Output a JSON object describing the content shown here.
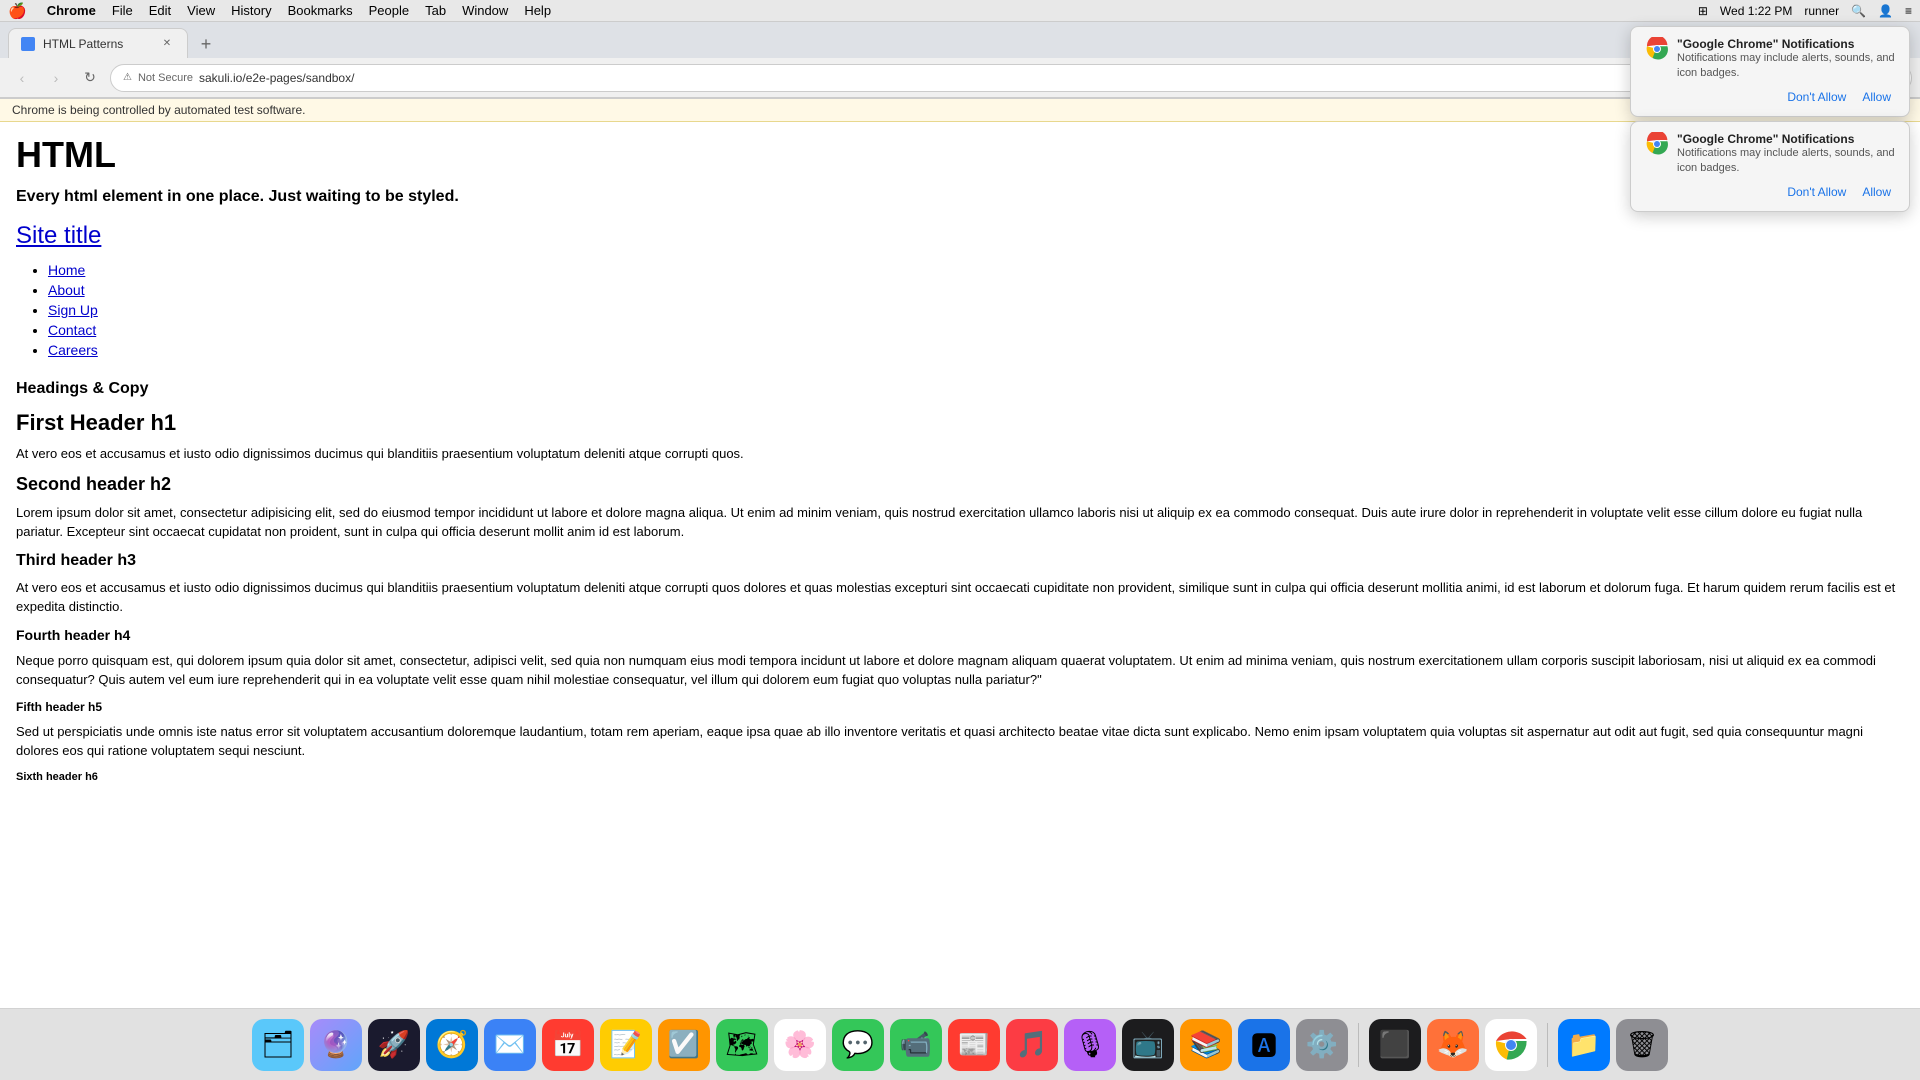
{
  "menubar": {
    "apple": "🍎",
    "items": [
      "Chrome",
      "File",
      "Edit",
      "View",
      "History",
      "Bookmarks",
      "People",
      "Tab",
      "Window",
      "Help"
    ],
    "chrome_bold": true,
    "right": {
      "datetime": "Wed 1:22 PM",
      "user": "runner"
    }
  },
  "browser": {
    "tab": {
      "title": "HTML Patterns",
      "favicon_color": "#4285f4"
    },
    "address": {
      "text": "sakuli.io/e2e-pages/sandbox/",
      "security": "Not Secure"
    }
  },
  "automation_bar": {
    "text": "Chrome is being controlled by automated test software."
  },
  "notification_popups": [
    {
      "id": "notif1",
      "title": "\"Google Chrome\" Notifications",
      "body": "Notifications may include alerts, sounds, and icon badges.",
      "dont_allow": "Don't Allow",
      "allow": "Allow"
    },
    {
      "id": "notif2",
      "title": "\"Google Chrome\" Notifications",
      "body": "Notifications may include alerts, sounds, and icon badges.",
      "dont_allow": "Don't Allow",
      "allow": "Allow"
    }
  ],
  "page": {
    "main_heading": "HTML",
    "subtitle": "Every html element in one place. Just waiting to be styled.",
    "site_title_link": "Site title",
    "nav_links": [
      {
        "label": "Home",
        "href": "#"
      },
      {
        "label": "About",
        "href": "#"
      },
      {
        "label": "Sign Up",
        "href": "#"
      },
      {
        "label": "Contact",
        "href": "#"
      },
      {
        "label": "Careers",
        "href": "#"
      }
    ],
    "sections_heading": "Headings & Copy",
    "h1_text": "First Header h1",
    "h1_para": "At vero eos et accusamus et iusto odio dignissimos ducimus qui blanditiis praesentium voluptatum deleniti atque corrupti quos.",
    "h2_text": "Second header h2",
    "h2_para": "Lorem ipsum dolor sit amet, consectetur adipisicing elit, sed do eiusmod tempor incididunt ut labore et dolore magna aliqua. Ut enim ad minim veniam, quis nostrud exercitation ullamco laboris nisi ut aliquip ex ea commodo consequat. Duis aute irure dolor in reprehenderit in voluptate velit esse cillum dolore eu fugiat nulla pariatur. Excepteur sint occaecat cupidatat non proident, sunt in culpa qui officia deserunt mollit anim id est laborum.",
    "h3_text": "Third header h3",
    "h3_para": "At vero eos et accusamus et iusto odio dignissimos ducimus qui blanditiis praesentium voluptatum deleniti atque corrupti quos dolores et quas molestias excepturi sint occaecati cupiditate non provident, similique sunt in culpa qui officia deserunt mollitia animi, id est laborum et dolorum fuga. Et harum quidem rerum facilis est et expedita distinctio.",
    "h4_text": "Fourth header h4",
    "h4_para": "Neque porro quisquam est, qui dolorem ipsum quia dolor sit amet, consectetur, adipisci velit, sed quia non numquam eius modi tempora incidunt ut labore et dolore magnam aliquam quaerat voluptatem. Ut enim ad minima veniam, quis nostrum exercitationem ullam corporis suscipit laboriosam, nisi ut aliquid ex ea commodi consequatur? Quis autem vel eum iure reprehenderit qui in ea voluptate velit esse quam nihil molestiae consequatur, vel illum qui dolorem eum fugiat quo voluptas nulla pariatur?\"",
    "h5_text": "Fifth header h5",
    "h5_para": "Sed ut perspiciatis unde omnis iste natus error sit voluptatem accusantium doloremque laudantium, totam rem aperiam, eaque ipsa quae ab illo inventore veritatis et quasi architecto beatae vitae dicta sunt explicabo. Nemo enim ipsam voluptatem quia voluptas sit aspernatur aut odit aut fugit, sed quia consequuntur magni dolores eos qui ratione voluptatem sequi nesciunt.",
    "h6_text": "Sixth header h6"
  },
  "dock": {
    "items": [
      {
        "name": "finder",
        "emoji": "🗂",
        "bg": "#5ac8fa"
      },
      {
        "name": "siri",
        "emoji": "🔮",
        "bg": "#7c7cff"
      },
      {
        "name": "launchpad",
        "emoji": "🚀",
        "bg": "#1a1a2e"
      },
      {
        "name": "safari",
        "emoji": "🧭",
        "bg": "#0078d7"
      },
      {
        "name": "mail",
        "emoji": "✉️",
        "bg": "#3b82f6"
      },
      {
        "name": "calendar",
        "emoji": "📅",
        "bg": "#ff3b30"
      },
      {
        "name": "notes",
        "emoji": "📝",
        "bg": "#ffcc02"
      },
      {
        "name": "reminders",
        "emoji": "☑️",
        "bg": "#ff9500"
      },
      {
        "name": "maps",
        "emoji": "🗺",
        "bg": "#34c759"
      },
      {
        "name": "photos",
        "emoji": "🌸",
        "bg": "#fff"
      },
      {
        "name": "messages",
        "emoji": "💬",
        "bg": "#34c759"
      },
      {
        "name": "facetime",
        "emoji": "📹",
        "bg": "#34c759"
      },
      {
        "name": "news",
        "emoji": "📰",
        "bg": "#ff3b30"
      },
      {
        "name": "music",
        "emoji": "🎵",
        "bg": "#fc3c44"
      },
      {
        "name": "podcasts",
        "emoji": "🎙",
        "bg": "#b560f7"
      },
      {
        "name": "appletv",
        "emoji": "📺",
        "bg": "#1c1c1e"
      },
      {
        "name": "books",
        "emoji": "📚",
        "bg": "#ff9500"
      },
      {
        "name": "appstore",
        "emoji": "🅰",
        "bg": "#1a73e8"
      },
      {
        "name": "systemprefs",
        "emoji": "⚙️",
        "bg": "#8e8e93"
      },
      {
        "name": "terminal",
        "emoji": "⬛",
        "bg": "#1c1c1e"
      },
      {
        "name": "firefox",
        "emoji": "🦊",
        "bg": "#ff7139"
      },
      {
        "name": "chrome",
        "emoji": "🌐",
        "bg": "#fff"
      },
      {
        "name": "files",
        "emoji": "📁",
        "bg": "#007aff"
      },
      {
        "name": "trash",
        "emoji": "🗑",
        "bg": "#8e8e93"
      }
    ]
  }
}
